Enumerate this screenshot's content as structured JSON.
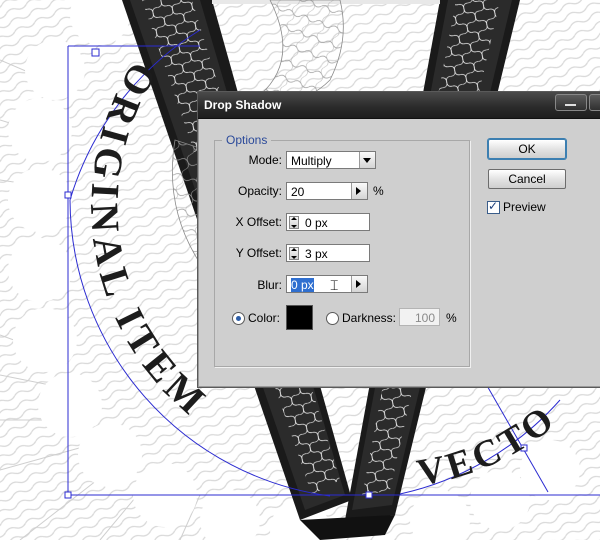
{
  "dialog": {
    "title": "Drop Shadow",
    "group_title": "Options",
    "mode": {
      "label": "Mode:",
      "value": "Multiply"
    },
    "opacity": {
      "label": "Opacity:",
      "value": "20",
      "unit": "%"
    },
    "x_offset": {
      "label": "X Offset:",
      "value": "0 px"
    },
    "y_offset": {
      "label": "Y Offset:",
      "value": "3 px"
    },
    "blur": {
      "label": "Blur:",
      "value": "0 px"
    },
    "color": {
      "label": "Color:",
      "swatch": "#000000",
      "selected": true
    },
    "darkness": {
      "label": "Darkness:",
      "value": "100",
      "unit": "%",
      "selected": false
    },
    "ok_label": "OK",
    "cancel_label": "Cancel",
    "preview": {
      "label": "Preview",
      "checked": true
    }
  },
  "artwork": {
    "arc_text_left": "ORIGINAL ITEM",
    "arc_text_right": "VECTO",
    "selection_color": "#2b2bd1"
  }
}
